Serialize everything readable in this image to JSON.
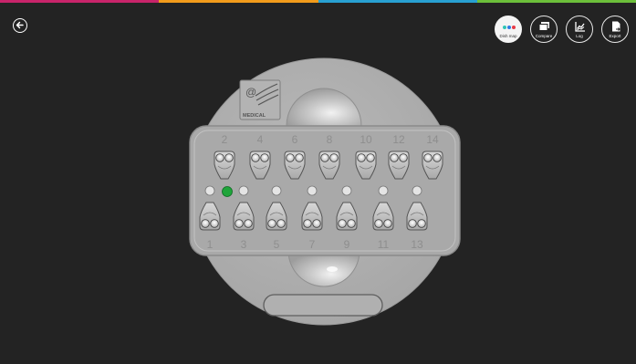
{
  "topbar_colors": [
    "#c8246a",
    "#f29b1b",
    "#28a0d2",
    "#6cbf3a"
  ],
  "toolbar": {
    "buttons": [
      {
        "id": "dish-map",
        "label": "Dish map",
        "icon": "dish-map-icon",
        "active": true
      },
      {
        "id": "compare",
        "label": "Compare",
        "icon": "compare-icon",
        "active": false
      },
      {
        "id": "log",
        "label": "Log",
        "icon": "log-chart-icon",
        "active": false
      },
      {
        "id": "export",
        "label": "Export",
        "icon": "export-icon",
        "active": false
      }
    ]
  },
  "dish": {
    "logo_text": "MEDICAL",
    "top_numbers": [
      "2",
      "4",
      "6",
      "8",
      "10",
      "12",
      "14"
    ],
    "bottom_numbers": [
      "1",
      "3",
      "5",
      "7",
      "9",
      "11",
      "13"
    ],
    "selected_well": "1",
    "selected_color": "#1fa53a"
  }
}
